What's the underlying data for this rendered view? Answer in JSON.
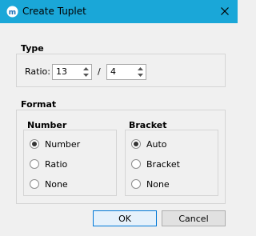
{
  "window": {
    "title": "Create Tuplet",
    "app_icon": "musescore-icon",
    "close_icon": "close-icon"
  },
  "type_section": {
    "label": "Type",
    "ratio_label": "Ratio:",
    "numerator": "13",
    "separator": "/",
    "denominator": "4"
  },
  "format_section": {
    "label": "Format",
    "number_group": {
      "label": "Number",
      "options": [
        "Number",
        "Ratio",
        "None"
      ],
      "selected": "Number"
    },
    "bracket_group": {
      "label": "Bracket",
      "options": [
        "Auto",
        "Bracket",
        "None"
      ],
      "selected": "Auto"
    }
  },
  "buttons": {
    "ok": "OK",
    "cancel": "Cancel"
  }
}
